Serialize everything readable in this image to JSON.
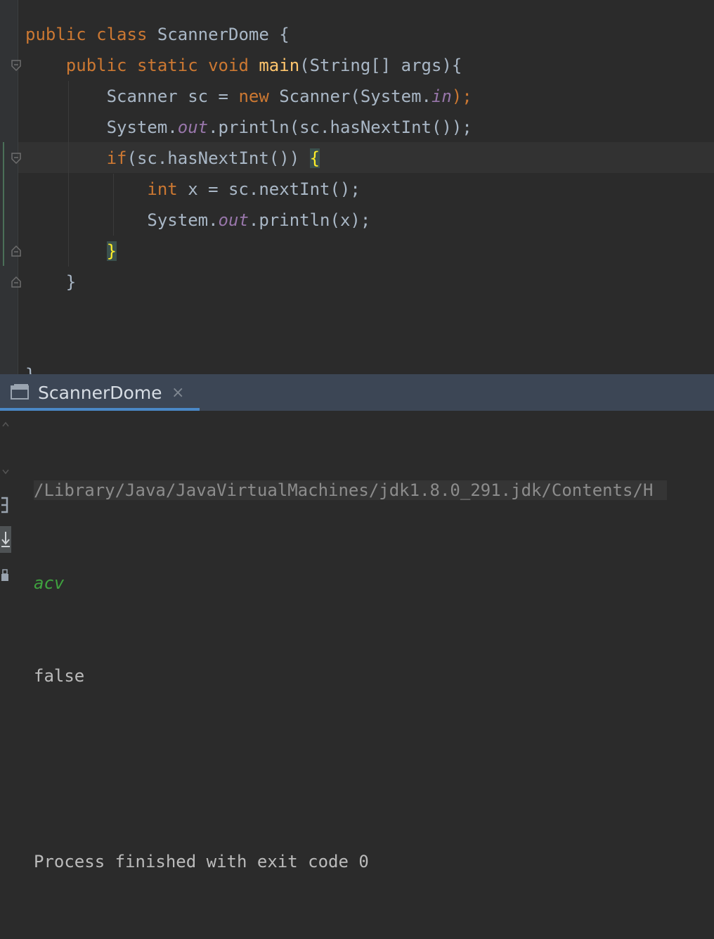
{
  "editor": {
    "lines": [
      {
        "parts": [
          {
            "t": "public ",
            "c": "kw"
          },
          {
            "t": "class ",
            "c": "kw"
          },
          {
            "t": "ScannerDome {",
            "c": ""
          }
        ]
      },
      {
        "parts": [
          {
            "t": "    public ",
            "c": "kw"
          },
          {
            "t": "static ",
            "c": "kw"
          },
          {
            "t": "void ",
            "c": "kw"
          },
          {
            "t": "main",
            "c": "fn"
          },
          {
            "t": "(String[] args){",
            "c": ""
          }
        ]
      },
      {
        "parts": [
          {
            "t": "        Scanner sc = ",
            "c": ""
          },
          {
            "t": "new ",
            "c": "kw"
          },
          {
            "t": "Scanner(System.",
            "c": ""
          },
          {
            "t": "in",
            "c": "fld"
          },
          {
            "t": ");",
            "c": "kw"
          }
        ]
      },
      {
        "parts": [
          {
            "t": "        System.",
            "c": ""
          },
          {
            "t": "out",
            "c": "fld"
          },
          {
            "t": ".println(sc.hasNextInt());",
            "c": ""
          }
        ]
      },
      {
        "parts": [
          {
            "t": "        ",
            "c": ""
          },
          {
            "t": "if",
            "c": "kw"
          },
          {
            "t": "(sc.hasNextInt()) ",
            "c": ""
          },
          {
            "t": "{",
            "c": "brace-hl"
          }
        ]
      },
      {
        "parts": [
          {
            "t": "            ",
            "c": ""
          },
          {
            "t": "int ",
            "c": "kw"
          },
          {
            "t": "x = sc.nextInt();",
            "c": ""
          }
        ]
      },
      {
        "parts": [
          {
            "t": "            System.",
            "c": ""
          },
          {
            "t": "out",
            "c": "fld"
          },
          {
            "t": ".println(x);",
            "c": ""
          }
        ]
      },
      {
        "parts": [
          {
            "t": "        ",
            "c": ""
          },
          {
            "t": "}",
            "c": "brace-hl"
          }
        ]
      },
      {
        "parts": [
          {
            "t": "    }",
            "c": ""
          }
        ]
      },
      {
        "parts": [
          {
            "t": "",
            "c": ""
          }
        ]
      },
      {
        "parts": [
          {
            "t": "",
            "c": ""
          }
        ]
      },
      {
        "parts": [
          {
            "t": "}",
            "c": ""
          }
        ]
      }
    ]
  },
  "run_panel": {
    "tab_label": "ScannerDome",
    "tab_close": "×",
    "console": {
      "command": "/Library/Java/JavaVirtualMachines/jdk1.8.0_291.jdk/Contents/H",
      "user_input": "acv",
      "output": "false",
      "blank": "",
      "exit_message": "Process finished with exit code 0"
    }
  },
  "colors": {
    "keyword": "#cc7832",
    "method": "#ffc66d",
    "field": "#9876aa",
    "text": "#a9b7c6",
    "input": "#3fa33f",
    "tab_accent": "#4a88c7"
  },
  "icons": [
    "fold-marker-icon",
    "console-window-icon",
    "close-icon",
    "scroll-up-icon",
    "scroll-down-icon",
    "soft-wrap-icon",
    "scroll-to-end-icon",
    "print-icon"
  ]
}
